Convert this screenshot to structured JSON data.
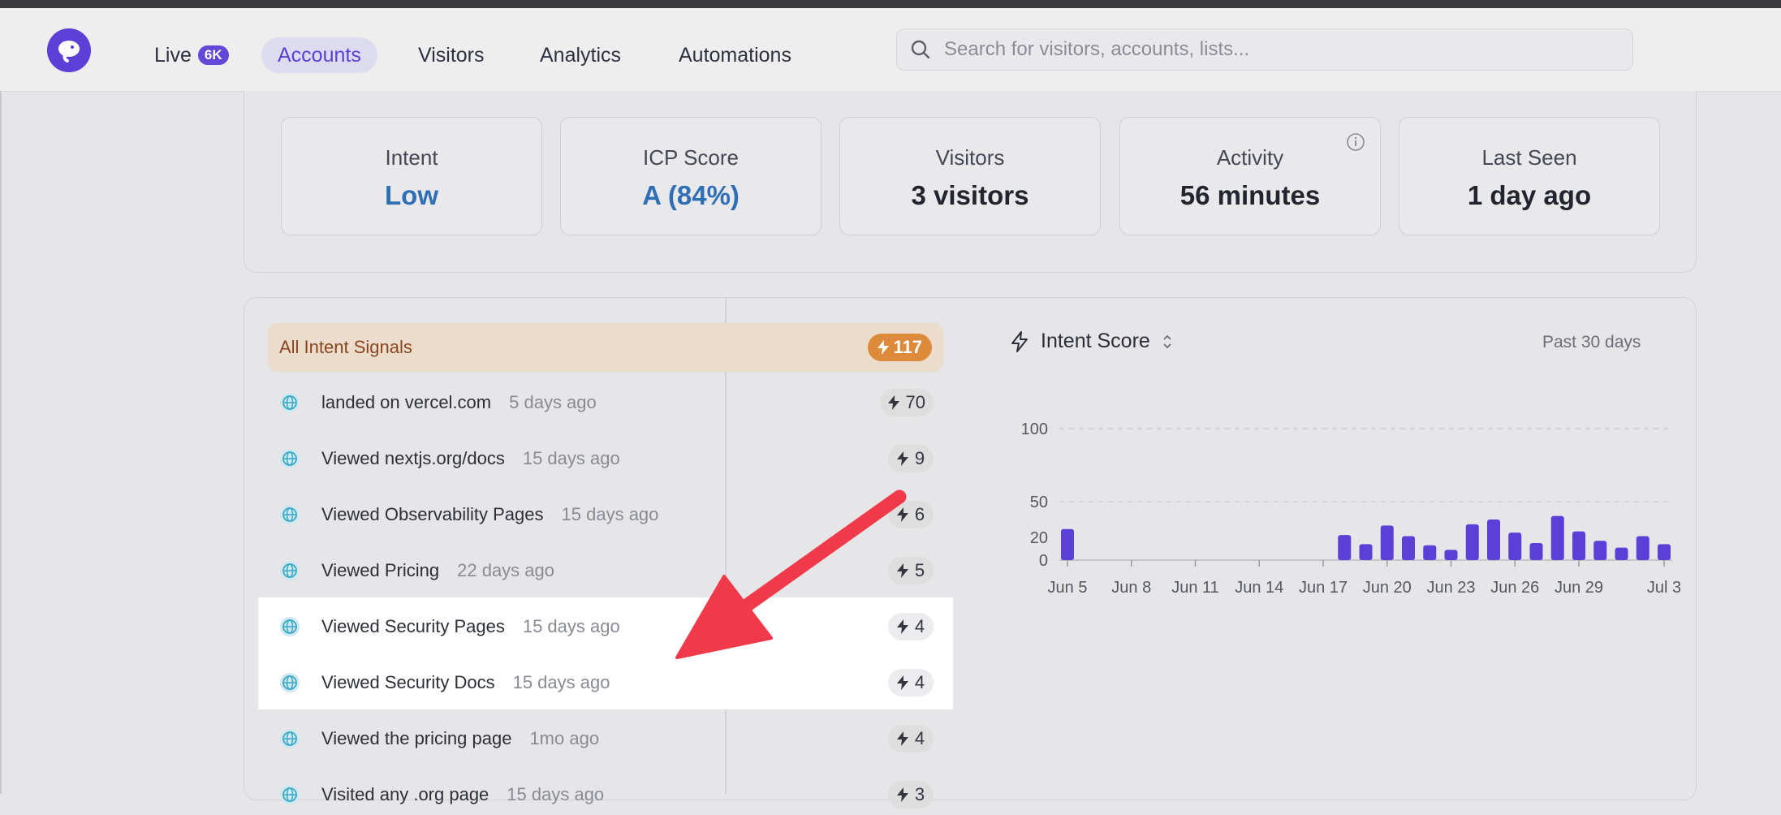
{
  "nav": {
    "live_label": "Live",
    "live_badge": "6K",
    "accounts": "Accounts",
    "visitors": "Visitors",
    "analytics": "Analytics",
    "automations": "Automations",
    "search_placeholder": "Search for visitors, accounts, lists..."
  },
  "stats": [
    {
      "label": "Intent",
      "value": "Low"
    },
    {
      "label": "ICP Score",
      "value": "A (84%)"
    },
    {
      "label": "Visitors",
      "value": "3 visitors"
    },
    {
      "label": "Activity",
      "value": "56 minutes"
    },
    {
      "label": "Last Seen",
      "value": "1 day ago"
    }
  ],
  "signals": {
    "header_label": "All Intent Signals",
    "header_score": "117",
    "items": [
      {
        "text": "landed on vercel.com",
        "time": "5 days ago",
        "score": "70"
      },
      {
        "text": "Viewed nextjs.org/docs",
        "time": "15 days ago",
        "score": "9"
      },
      {
        "text": "Viewed Observability Pages",
        "time": "15 days ago",
        "score": "6"
      },
      {
        "text": "Viewed Pricing",
        "time": "22 days ago",
        "score": "5"
      },
      {
        "text": "Viewed Security Pages",
        "time": "15 days ago",
        "score": "4"
      },
      {
        "text": "Viewed Security Docs",
        "time": "15 days ago",
        "score": "4"
      },
      {
        "text": "Viewed the pricing page",
        "time": "1mo ago",
        "score": "4"
      },
      {
        "text": "Visited any .org page",
        "time": "15 days ago",
        "score": "3"
      }
    ]
  },
  "chart_header": {
    "title": "Intent Score",
    "range": "Past 30 days"
  },
  "chart_data": {
    "type": "bar",
    "ylim": [
      0,
      100
    ],
    "y_ticks": [
      0,
      20,
      50,
      100
    ],
    "x_ticks": [
      "Jun 5",
      "Jun 8",
      "Jun 11",
      "Jun 14",
      "Jun 17",
      "Jun 20",
      "Jun 23",
      "Jun 26",
      "Jun 29",
      "Jul 3"
    ],
    "categories": [
      "Jun 5",
      "Jun 6",
      "Jun 7",
      "Jun 8",
      "Jun 9",
      "Jun 10",
      "Jun 11",
      "Jun 12",
      "Jun 13",
      "Jun 14",
      "Jun 15",
      "Jun 16",
      "Jun 17",
      "Jun 18",
      "Jun 19",
      "Jun 20",
      "Jun 21",
      "Jun 22",
      "Jun 23",
      "Jun 24",
      "Jun 25",
      "Jun 26",
      "Jun 27",
      "Jun 28",
      "Jun 29",
      "Jun 30",
      "Jul 1",
      "Jul 2",
      "Jul 3"
    ],
    "values": [
      27,
      0,
      0,
      0,
      0,
      0,
      0,
      0,
      0,
      0,
      0,
      0,
      0,
      22,
      14,
      30,
      21,
      13,
      9,
      31,
      35,
      24,
      15,
      38,
      25,
      17,
      11,
      21,
      14
    ],
    "color": "#5b3fd6"
  }
}
